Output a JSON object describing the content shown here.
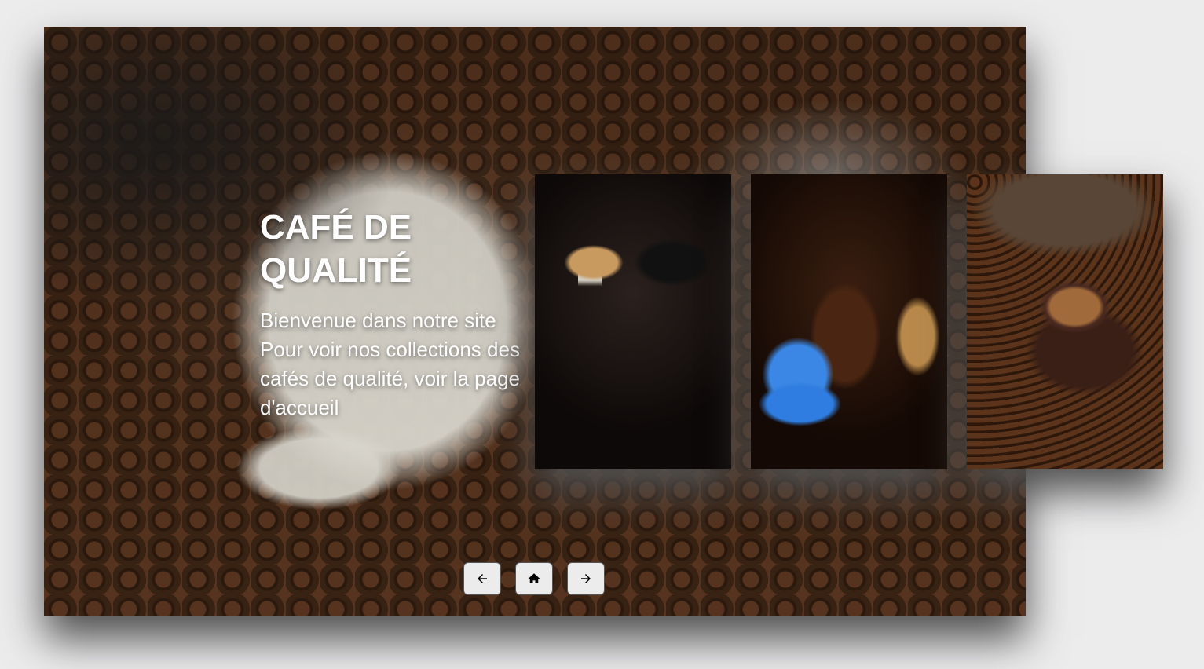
{
  "hero": {
    "title": "CAFÉ DE QUALITÉ",
    "description": "Bienvenue dans notre site Pour voir nos collections des cafés de qualité, voir la page d'accueil"
  },
  "thumbnails": [
    {
      "alt": "coffee-pour-image"
    },
    {
      "alt": "coffee-grinder-image"
    },
    {
      "alt": "coffee-cup-beans-image"
    }
  ],
  "nav": {
    "prev_icon": "arrow-left-icon",
    "home_icon": "home-icon",
    "next_icon": "arrow-right-icon"
  },
  "colors": {
    "page_background": "#ececed",
    "text": "#ffffff",
    "button_background": "#ececed"
  }
}
